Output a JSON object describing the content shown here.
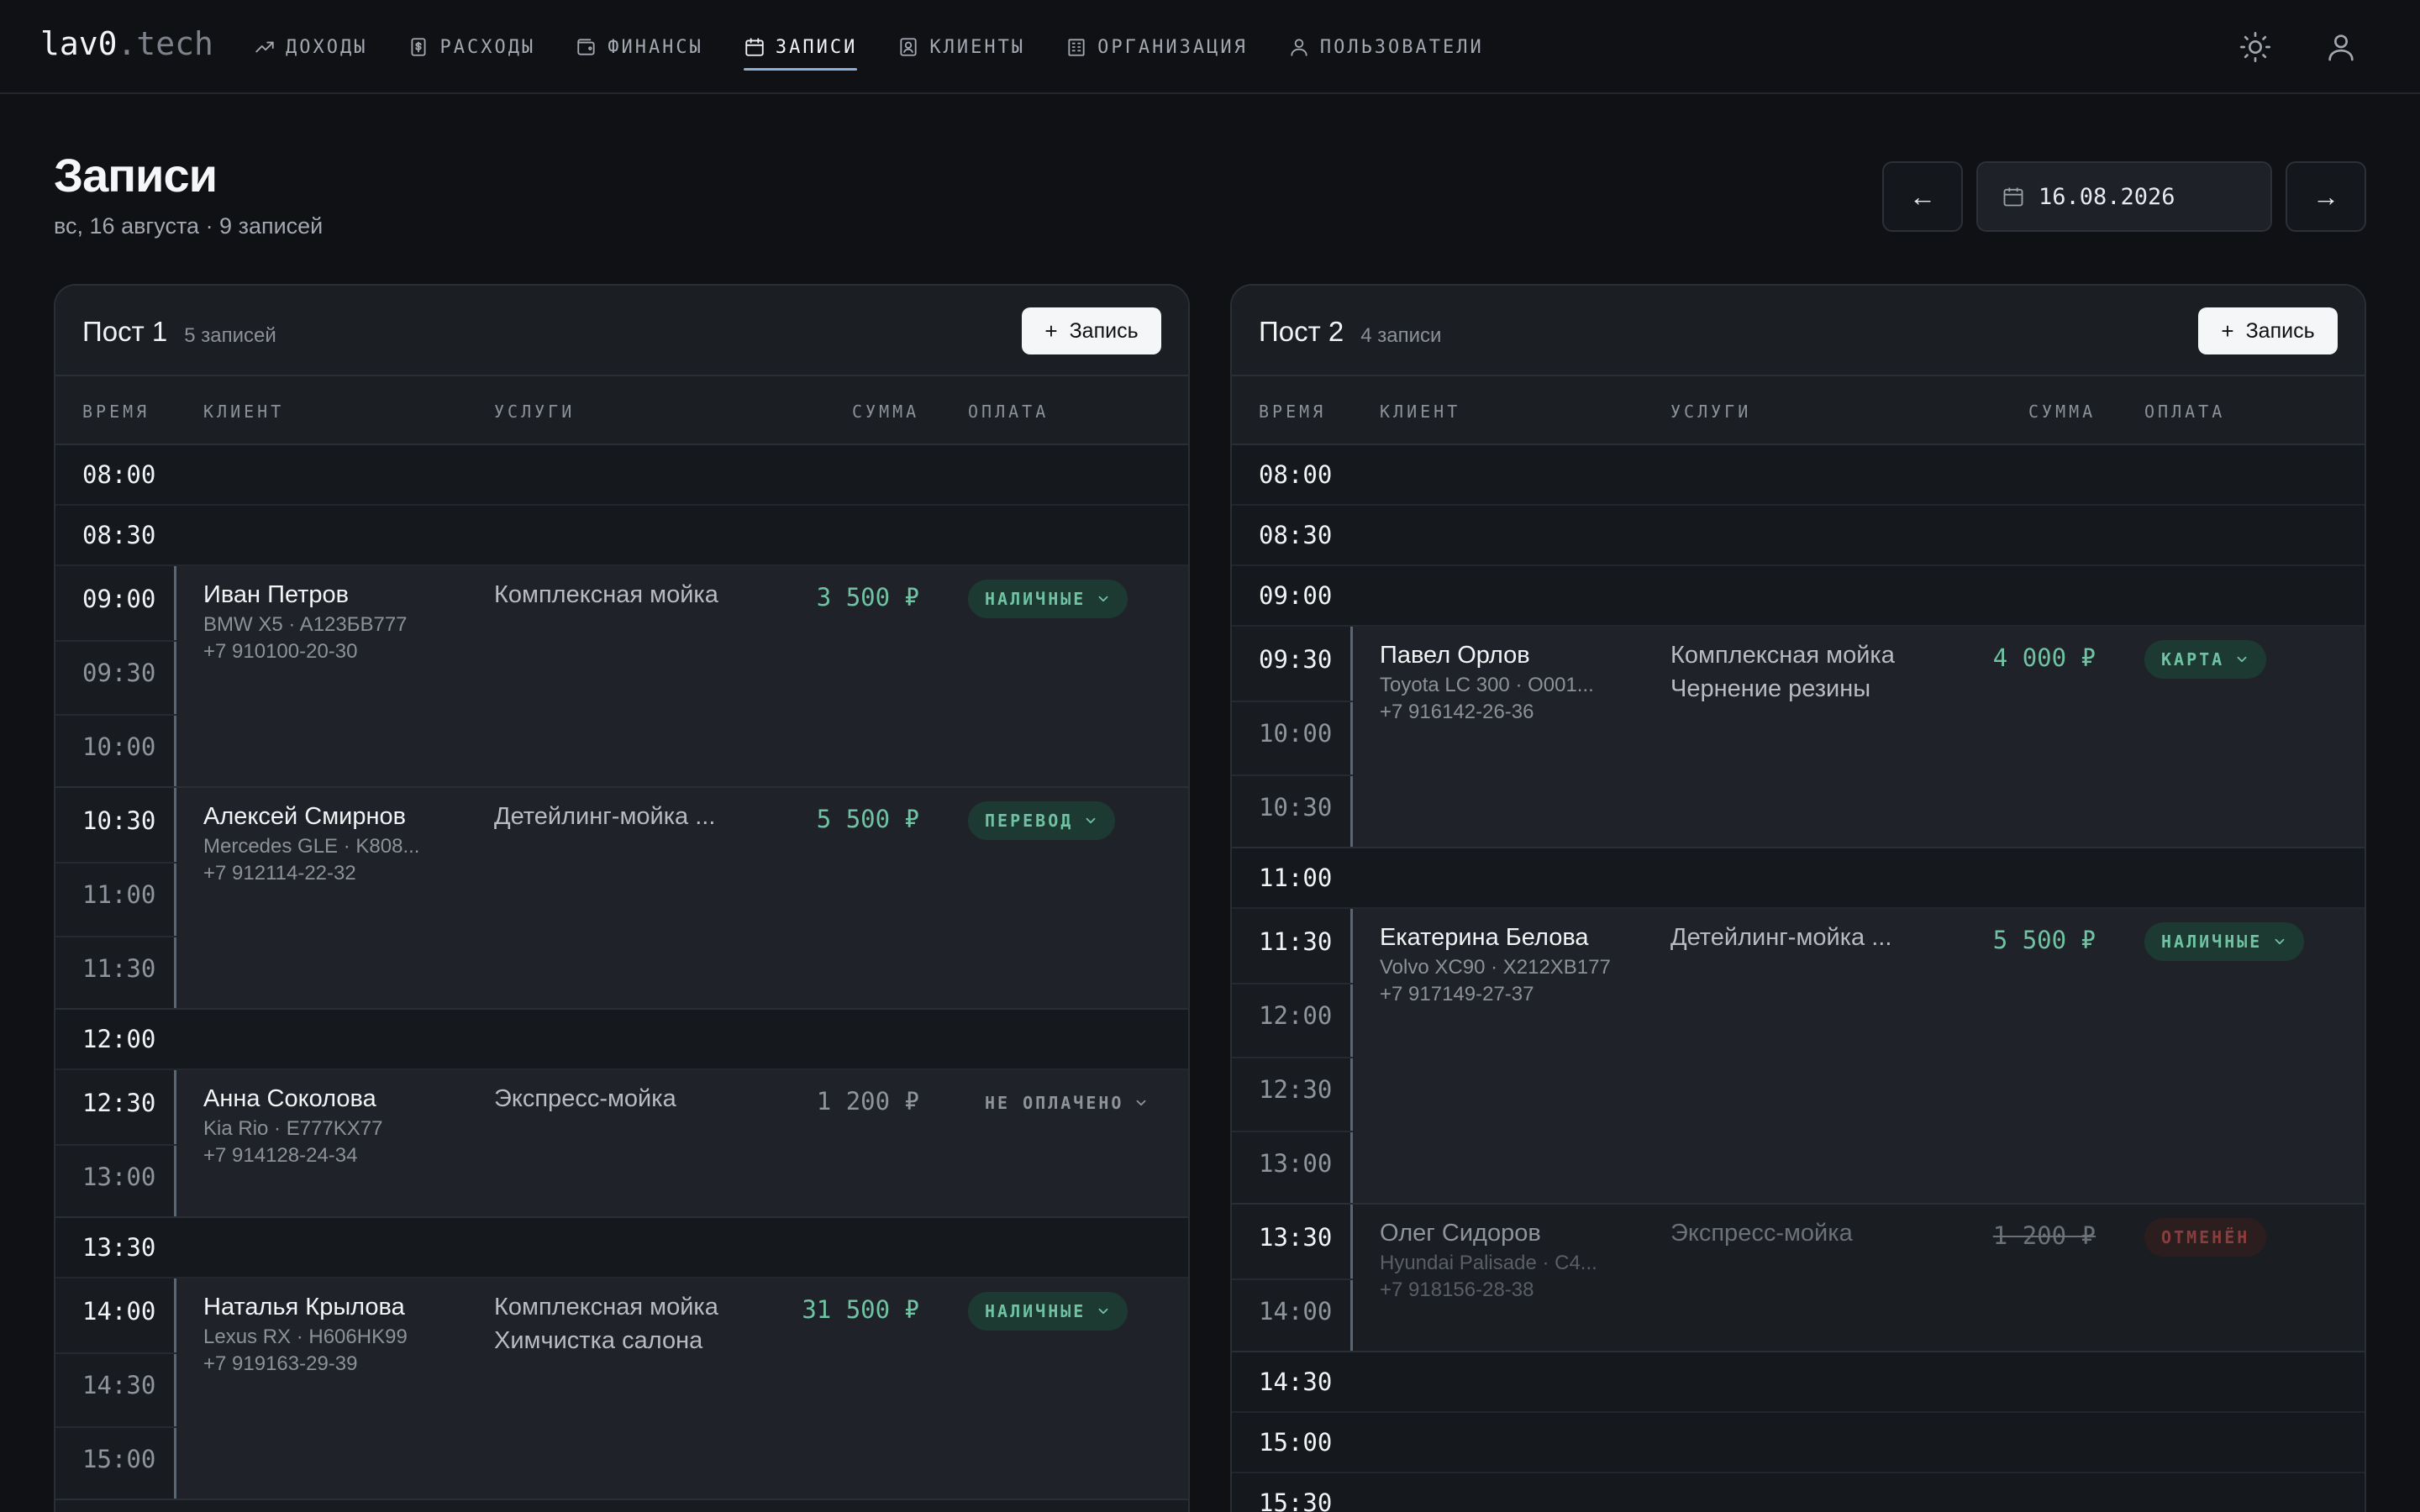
{
  "app": {
    "logo_main": "lav0",
    "logo_suffix": ".tech"
  },
  "nav": [
    {
      "label": "ДОХОДЫ",
      "icon": "trending-up-icon"
    },
    {
      "label": "РАСХОДЫ",
      "icon": "receipt-icon"
    },
    {
      "label": "ФИНАНСЫ",
      "icon": "wallet-icon"
    },
    {
      "label": "ЗАПИСИ",
      "icon": "calendar-icon",
      "active": true
    },
    {
      "label": "КЛИЕНТЫ",
      "icon": "contact-icon"
    },
    {
      "label": "ОРГАНИЗАЦИЯ",
      "icon": "building-icon"
    },
    {
      "label": "ПОЛЬЗОВАТЕЛИ",
      "icon": "user-icon"
    }
  ],
  "header": {
    "title": "Записи",
    "subtitle": "вс, 16 августа · 9 записей",
    "prev_label": "←",
    "next_label": "→",
    "date_value": "16.08.2026"
  },
  "columns": {
    "time": "ВРЕМЯ",
    "client": "КЛИЕНТ",
    "services": "УСЛУГИ",
    "sum": "СУММА",
    "payment": "ОПЛАТА"
  },
  "add_label": "Запись",
  "colors": {
    "accent": "#8ab0d8",
    "paid": "#6fc2a2",
    "cancelled": "#8a3d3a",
    "background": "#0f1114"
  },
  "posts": [
    {
      "title": "Пост 1",
      "count": "5 записей",
      "slots": [
        "08:00",
        "08:30",
        "12:00",
        "13:30"
      ],
      "bookings": [
        {
          "times": [
            "09:00",
            "09:30",
            "10:00"
          ],
          "name": "Иван Петров",
          "car": "BMW X5 · A123БВ777",
          "phone": "+7 910100-20-30",
          "services": [
            "Комплексная мойка"
          ],
          "sum": "3 500 ₽",
          "payment": "НАЛИЧНЫЕ",
          "status": "paid"
        },
        {
          "times": [
            "10:30",
            "11:00",
            "11:30"
          ],
          "name": "Алексей Смирнов",
          "car": "Mercedes GLE · K808...",
          "phone": "+7 912114-22-32",
          "services": [
            "Детейлинг-мойка ..."
          ],
          "sum": "5 500 ₽",
          "payment": "ПЕРЕВОД",
          "status": "paid"
        },
        {
          "times": [
            "12:30",
            "13:00"
          ],
          "name": "Анна Соколова",
          "car": "Kia Rio · E777KX77",
          "phone": "+7 914128-24-34",
          "services": [
            "Экспресс-мойка"
          ],
          "sum": "1 200 ₽",
          "payment": "НЕ ОПЛАЧЕНО",
          "status": "unpaid"
        },
        {
          "times": [
            "14:00",
            "14:30",
            "15:00"
          ],
          "name": "Наталья Крылова",
          "car": "Lexus RX · H606HK99",
          "phone": "+7 919163-29-39",
          "services": [
            "Комплексная мойка",
            "Химчистка салона"
          ],
          "sum": "31 500 ₽",
          "payment": "НАЛИЧНЫЕ",
          "status": "paid"
        }
      ]
    },
    {
      "title": "Пост 2",
      "count": "4 записи",
      "slots": [
        "08:00",
        "08:30",
        "09:00",
        "11:00",
        "14:30",
        "15:00",
        "15:30"
      ],
      "bookings": [
        {
          "times": [
            "09:30",
            "10:00",
            "10:30"
          ],
          "name": "Павел Орлов",
          "car": "Toyota LC 300 · O001...",
          "phone": "+7 916142-26-36",
          "services": [
            "Комплексная мойка",
            "Чернение резины"
          ],
          "sum": "4 000 ₽",
          "payment": "КАРТА",
          "status": "paid"
        },
        {
          "times": [
            "11:30",
            "12:00",
            "12:30",
            "13:00"
          ],
          "name": "Екатерина Белова",
          "car": "Volvo XC90 · X212XB177",
          "phone": "+7 917149-27-37",
          "services": [
            "Детейлинг-мойка ..."
          ],
          "sum": "5 500 ₽",
          "payment": "НАЛИЧНЫЕ",
          "status": "paid"
        },
        {
          "times": [
            "13:30",
            "14:00"
          ],
          "name": "Олег Сидоров",
          "car": "Hyundai Palisade · C4...",
          "phone": "+7 918156-28-38",
          "services": [
            "Экспресс-мойка"
          ],
          "sum": "1 200 ₽",
          "payment": "ОТМЕНЁН",
          "status": "cancelled"
        }
      ]
    }
  ]
}
